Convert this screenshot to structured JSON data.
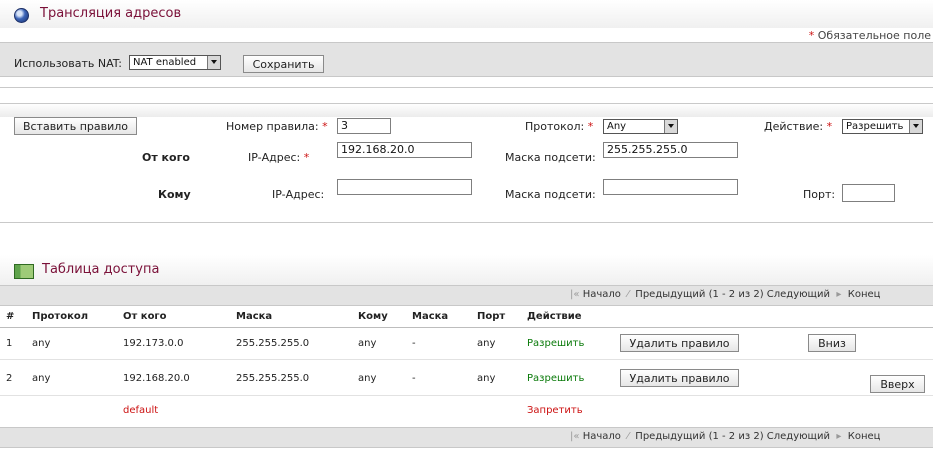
{
  "header": {
    "title": "Трансляция адресов",
    "required_note": "Обязательное поле"
  },
  "nat": {
    "label": "Использовать NAT:",
    "value": "NAT enabled",
    "save_label": "Сохранить"
  },
  "rule_form": {
    "insert_label": "Вставить правило",
    "rule_no_label": "Номер правила:",
    "rule_no_value": "3",
    "protocol_label": "Протокол:",
    "protocol_value": "Any",
    "action_label": "Действие:",
    "action_value": "Разрешить",
    "from_label": "От кого",
    "to_label": "Кому",
    "ip_label": "IP-Адрес:",
    "mask_label": "Маска подсети:",
    "port_label": "Порт:",
    "from_ip": "192.168.20.0",
    "from_mask": "255.255.255.0",
    "to_ip": "",
    "to_mask": "",
    "to_port": ""
  },
  "access_table": {
    "title": "Таблица доступа",
    "columns": [
      "#",
      "Протокол",
      "От кого",
      "Маска",
      "Кому",
      "Маска",
      "Порт",
      "Действие"
    ],
    "rows": [
      {
        "num": "1",
        "protocol": "any",
        "from": "192.173.0.0",
        "mask": "255.255.255.0",
        "to": "any",
        "mask2": "-",
        "port": "any",
        "action": "Разрешить",
        "delete_label": "Удалить правило",
        "move_label": "Вниз"
      },
      {
        "num": "2",
        "protocol": "any",
        "from": "192.168.20.0",
        "mask": "255.255.255.0",
        "to": "any",
        "mask2": "-",
        "port": "any",
        "action": "Разрешить",
        "delete_label": "Удалить правило",
        "move_label": "Вверх"
      }
    ],
    "default_row": {
      "label": "default",
      "action": "Запретить"
    }
  },
  "pager": {
    "first": "Начало",
    "prev": "Предыдущий",
    "range": "(1 - 2 из 2)",
    "next": "Следующий",
    "last": "Конец"
  }
}
